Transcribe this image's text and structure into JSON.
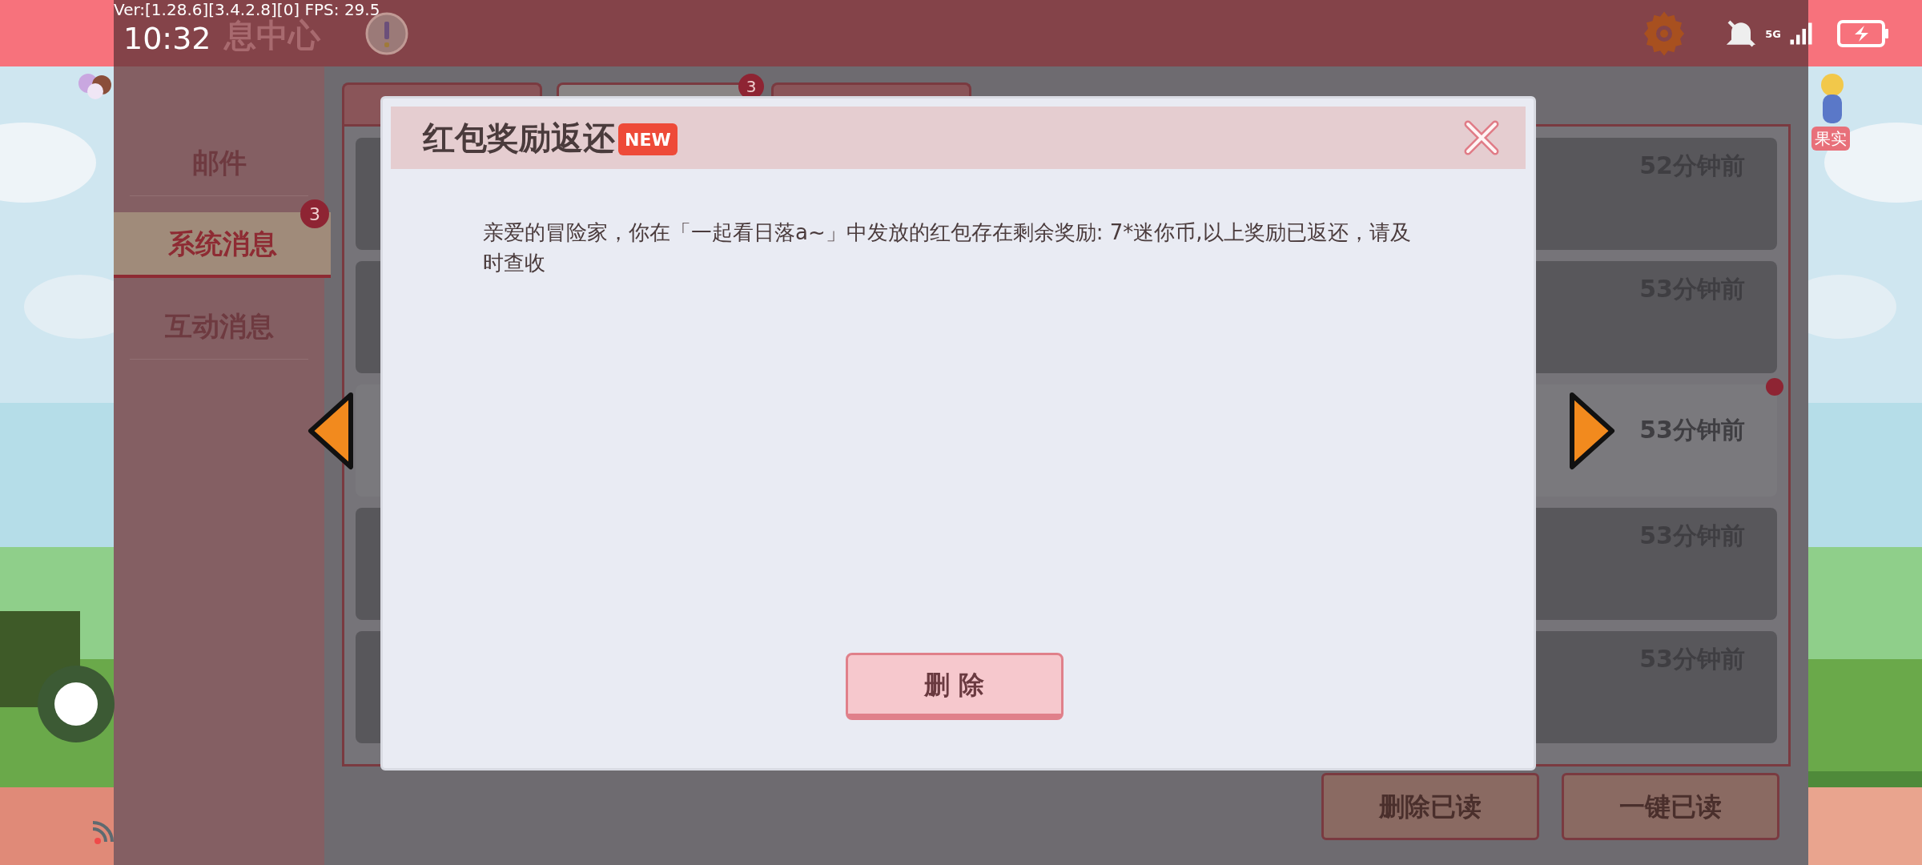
{
  "status_bar": {
    "version": "Ver:[1.28.6][3.4.2.8][0] FPS: 29.5",
    "time": "10:32",
    "network": "5G"
  },
  "header": {
    "title": "息中心"
  },
  "side_label": "果实",
  "sidebar": {
    "items": [
      {
        "label": "邮件",
        "selected": false
      },
      {
        "label": "系统消息",
        "selected": true,
        "badge": "3"
      },
      {
        "label": "互动消息",
        "selected": false
      }
    ]
  },
  "tabs": [
    {
      "selected": false
    },
    {
      "selected": true,
      "badge": "3"
    },
    {
      "selected": false
    }
  ],
  "messages": [
    {
      "time": "52分钟前",
      "selected": false,
      "unread": false
    },
    {
      "time": "53分钟前",
      "selected": false,
      "unread": false
    },
    {
      "time": "53分钟前",
      "selected": true,
      "unread": true
    },
    {
      "time": "53分钟前",
      "selected": false,
      "unread": false
    },
    {
      "time": "53分钟前",
      "selected": false,
      "unread": false
    }
  ],
  "footer_buttons": [
    "删除已读",
    "一键已读"
  ],
  "dialog": {
    "title": "红包奖励返还",
    "badge": "NEW",
    "body": "亲爱的冒险家，你在「一起看日落a~」中发放的红包存在剩余奖励: 7*迷你币,以上奖励已返还，请及时查收",
    "button": "删 除"
  }
}
